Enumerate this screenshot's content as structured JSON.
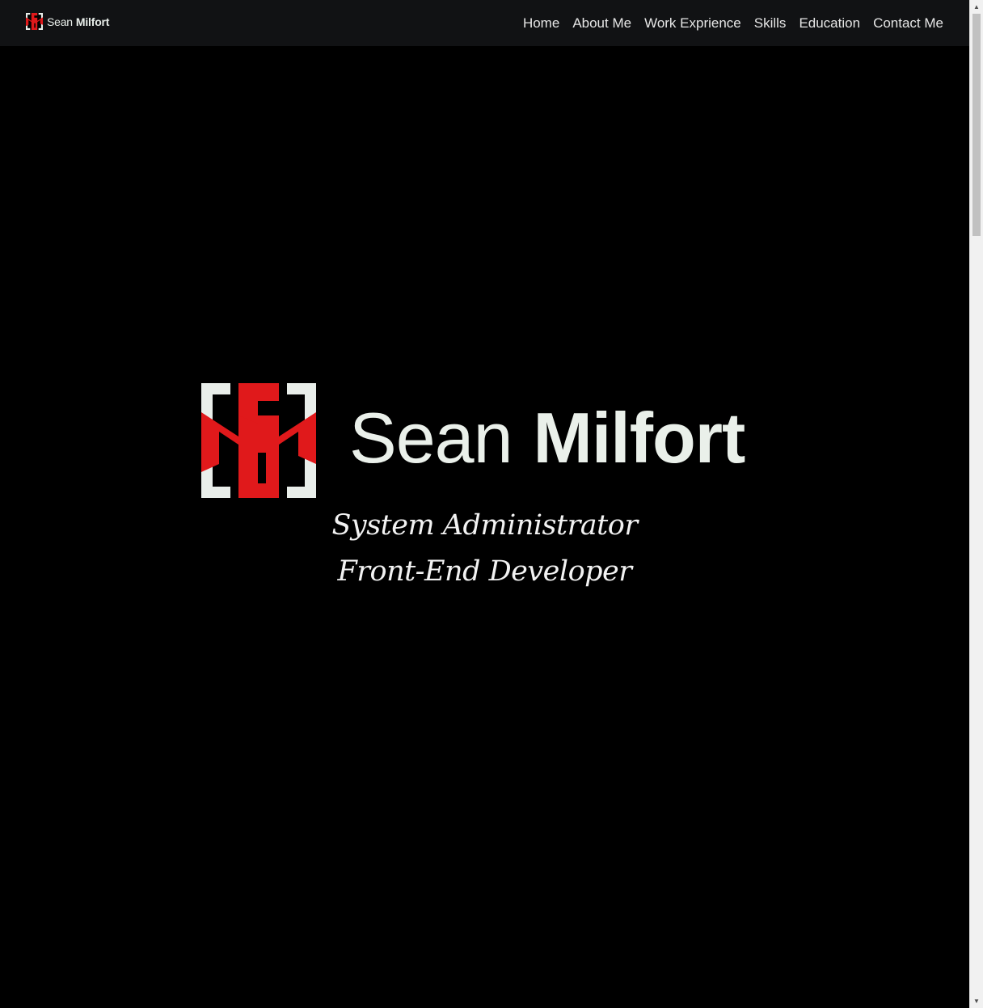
{
  "navbar": {
    "brand": {
      "first": "Sean",
      "last": "Milfort"
    },
    "links": [
      {
        "label": "Home"
      },
      {
        "label": "About Me"
      },
      {
        "label": "Work Exprience"
      },
      {
        "label": "Skills"
      },
      {
        "label": "Education"
      },
      {
        "label": "Contact Me"
      }
    ]
  },
  "hero": {
    "first_name": "Sean",
    "last_name": "Milfort",
    "taglines": [
      "System Administrator",
      "Front-End Developer"
    ]
  },
  "colors": {
    "background": "#000000",
    "navbar": "#111214",
    "logo_red": "#e0191b",
    "logo_light": "#e9eeea"
  },
  "icons": {
    "logo": "sm-monogram-logo",
    "scroll_up": "scroll-up-arrow-icon",
    "scroll_down": "scroll-down-arrow-icon"
  }
}
